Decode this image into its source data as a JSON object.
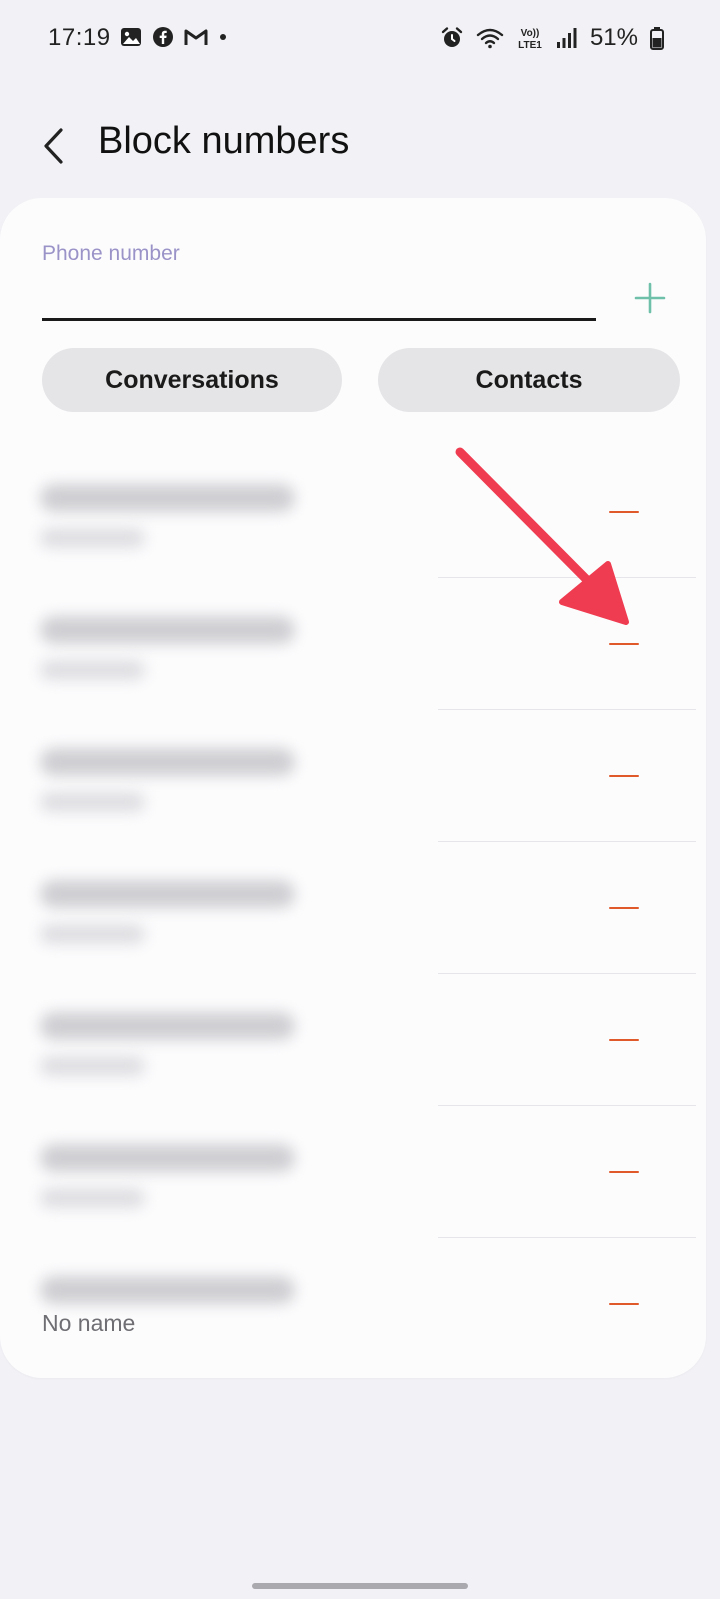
{
  "status_bar": {
    "time": "17:19",
    "battery": "51%",
    "network_label": "Vo)) LTE1",
    "left_icons": [
      "gallery-icon",
      "facebook-icon",
      "gmail-icon",
      "dot-icon"
    ],
    "right_icons": [
      "alarm-icon",
      "wifi-icon",
      "volte-icon",
      "signal-icon",
      "battery-icon"
    ]
  },
  "header": {
    "title": "Block numbers",
    "back_icon": "chevron-left-icon"
  },
  "phone_input": {
    "label": "Phone number",
    "value": "",
    "add_icon": "plus-icon"
  },
  "buttons": {
    "conversations": "Conversations",
    "contacts": "Contacts"
  },
  "blocked_list": {
    "items": [
      {
        "subtext": ""
      },
      {
        "subtext": ""
      },
      {
        "subtext": ""
      },
      {
        "subtext": ""
      },
      {
        "subtext": ""
      },
      {
        "subtext": ""
      },
      {
        "subtext": "No name"
      }
    ],
    "remove_icon": "minus-icon"
  },
  "colors": {
    "background": "#f2f2f6",
    "card": "#fcfcfd",
    "accent_remove": "#e0592a",
    "add_icon": "#6fc0a8",
    "label": "#9a93c8",
    "annotation_arrow": "#f03c50"
  }
}
